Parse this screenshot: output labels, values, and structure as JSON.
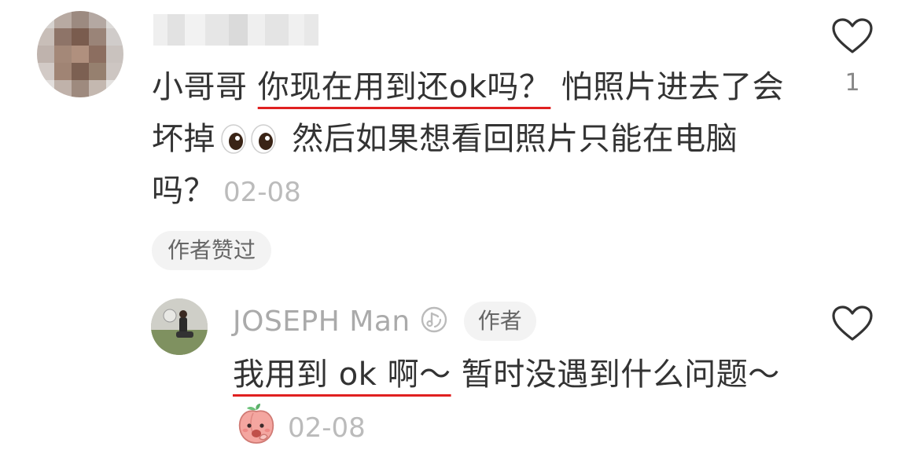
{
  "comment": {
    "text_part1": "小哥哥 ",
    "text_underlined": "你现在用到还ok吗？",
    "text_part2": " 怕照片进去了会坏掉",
    "text_part3": " 然后如果想看回照片只能在电脑吗？",
    "date": "02-08",
    "like_count": "1",
    "liked_badge": "作者赞过"
  },
  "reply": {
    "username": "JOSEPH Man",
    "author_badge": "作者",
    "text_underlined": "我用到 ok 啊～",
    "text_part2": " 暂时没遇到什么问题～",
    "date": "02-08"
  },
  "colors": {
    "underline": "#e02020",
    "text": "#333333",
    "muted": "#bbbbbb",
    "badge_bg": "#f3f3f3"
  },
  "icons": {
    "like": "heart-outline-icon",
    "verified": "music-disc-icon",
    "eyes": "eyes-emoji-icon",
    "peach": "peach-emoji-icon"
  }
}
